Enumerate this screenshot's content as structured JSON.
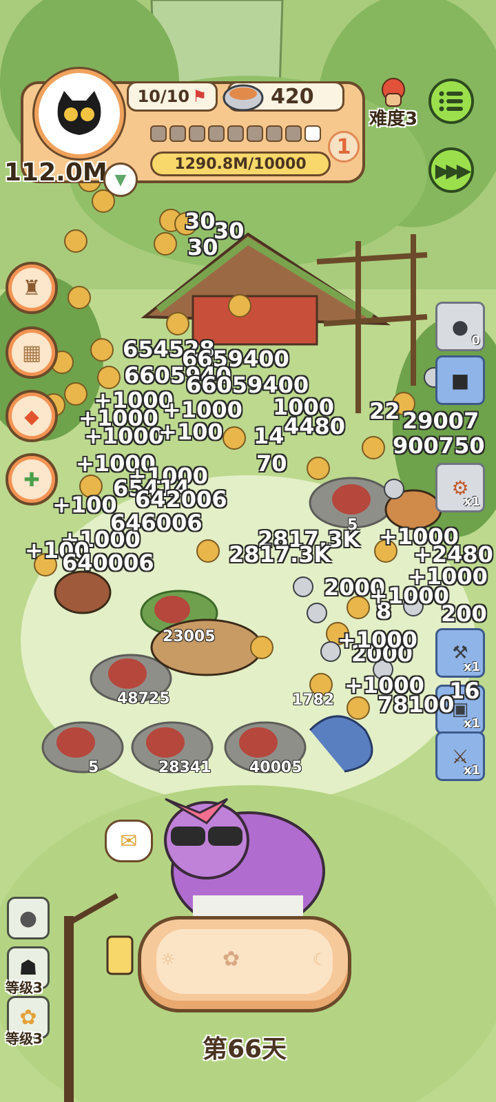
{
  "hud": {
    "population": "10/10",
    "food": "420",
    "xp": "1290.8M/10000",
    "level": "1",
    "money": "112.0M",
    "difficulty": "难度3",
    "progress_filled": 1,
    "progress_total": 9
  },
  "floating_numbers": [
    "30",
    "30",
    "30",
    "654528",
    "6659400",
    "6605940",
    "66059400",
    "+1000",
    "+1000",
    "+1000",
    "+1000",
    "+1000",
    "+1000",
    "+1000",
    "+1000",
    "+1000",
    "+100",
    "+100",
    "+100",
    "1000",
    "14",
    "4480",
    "22",
    "29007",
    "900750",
    "65414",
    "70",
    "642006",
    "646006",
    "640006",
    "2817.3K",
    "2817.3K",
    "+2480",
    "+1000",
    "2000",
    "200",
    "8",
    "2000",
    "+1000",
    "+1000",
    "16",
    "78100"
  ],
  "slab_values": [
    "23005",
    "48725",
    "5",
    "28341",
    "40005",
    "5",
    "1782"
  ],
  "right_cards": [
    {
      "icon": "paw-coins-icon",
      "count": "0"
    },
    {
      "icon": "ribbon-box-icon",
      "count": ""
    },
    {
      "icon": "trap-device-icon",
      "count": "x1"
    },
    {
      "icon": "gear-tool-icon",
      "count": "x1"
    },
    {
      "icon": "food-pack-icon",
      "count": "x1"
    },
    {
      "icon": "axe-icon",
      "count": "x1"
    }
  ],
  "bottom_left": {
    "level_label_1": "等级3",
    "level_label_2": "等级3"
  },
  "day_label": "第66天"
}
